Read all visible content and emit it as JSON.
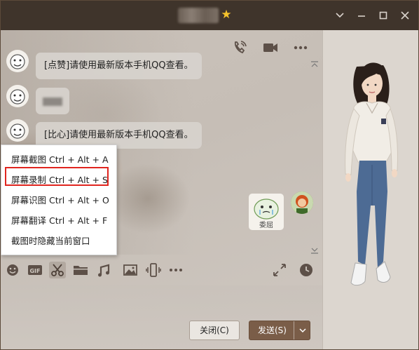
{
  "window": {
    "title_badge": "★",
    "controls": [
      "minimize",
      "maximize",
      "close",
      "dropdown"
    ]
  },
  "chat": {
    "messages": [
      {
        "text": "[点赞]请使用最新版本手机QQ查看。"
      },
      {
        "text": ""
      },
      {
        "text": "[比心]请使用最新版本手机QQ查看。"
      }
    ],
    "sticker_caption": "委屈"
  },
  "context_menu": {
    "items": [
      "屏幕截图 Ctrl + Alt + A",
      "屏幕录制 Ctrl + Alt + S",
      "屏幕识图 Ctrl + Alt + O",
      "屏幕翻译 Ctrl + Alt + F",
      "截图时隐藏当前窗口"
    ],
    "highlighted_index": 1,
    "highlight_color": "#e0251f"
  },
  "toolbar": {
    "icons": [
      "emoji-icon",
      "gif-icon",
      "scissors-icon",
      "folder-icon",
      "music-note-icon",
      "image-icon",
      "phone-vibrate-icon",
      "more-icon",
      "expand-icon",
      "clock-icon"
    ]
  },
  "buttons": {
    "close_label": "关闭(C)",
    "send_label": "发送(S)"
  },
  "colors": {
    "titlebar": "#3f342b",
    "send_button": "#7a5d48",
    "star": "#f5c32c"
  }
}
